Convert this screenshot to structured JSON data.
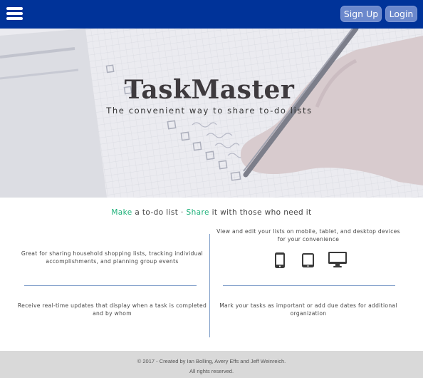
{
  "navbar": {
    "menu_icon": "hamburger-menu-icon",
    "signup_label": "Sign Up",
    "login_label": "Login",
    "background_color": "#003399",
    "button_color": "#6b88cc"
  },
  "hero": {
    "title": "TaskMaster",
    "subtitle": "The convenient way to share to-do lists"
  },
  "tagline": {
    "make": "Make",
    "part1": " a to-do list · ",
    "share": "Share",
    "part2": " it with those who need it",
    "accent_color": "#1db079"
  },
  "features": {
    "sharing": "Great for sharing household shopping lists, tracking individual accomplishments, and planning group events",
    "devices": "View and edit your lists on mobile, tablet, and desktop devices for your convenience",
    "realtime": "Receive real-time updates that display when a task is completed and by whom",
    "organization": "Mark your tasks as important or add due dates for additional organization",
    "device_icons": [
      "mobile-phone-icon",
      "tablet-icon",
      "desktop-monitor-icon"
    ]
  },
  "footer": {
    "credit": "© 2017 - Created by Ian Bolling, Avery Effs and Jeff Weinreich.",
    "rights": "All rights reserved."
  }
}
